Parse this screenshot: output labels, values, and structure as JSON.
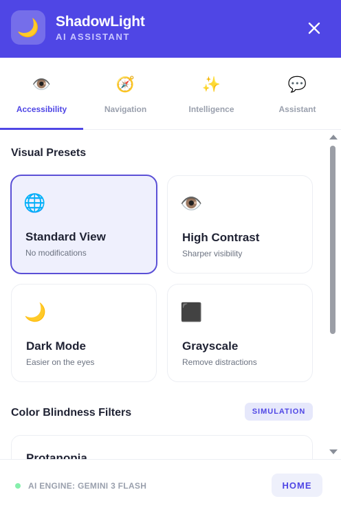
{
  "header": {
    "title": "ShadowLight",
    "subtitle": "AI ASSISTANT",
    "logo_icon": "crescent-moon-icon",
    "logo_glyph": "🌙",
    "close_icon": "close-icon"
  },
  "tabs": [
    {
      "label": "Accessibility",
      "icon": "eye-icon",
      "glyph": "👁️",
      "active": true
    },
    {
      "label": "Navigation",
      "icon": "compass-icon",
      "glyph": "🧭",
      "active": false
    },
    {
      "label": "Intelligence",
      "icon": "sparkles-icon",
      "glyph": "✨",
      "active": false
    },
    {
      "label": "Assistant",
      "icon": "speech-bubble-icon",
      "glyph": "💬",
      "active": false
    }
  ],
  "visual_presets": {
    "title": "Visual Presets",
    "items": [
      {
        "title": "Standard View",
        "subtitle": "No modifications",
        "icon": "globe-icon",
        "glyph": "🌐",
        "selected": true
      },
      {
        "title": "High Contrast",
        "subtitle": "Sharper visibility",
        "icon": "eye-icon",
        "glyph": "👁️",
        "selected": false
      },
      {
        "title": "Dark Mode",
        "subtitle": "Easier on the eyes",
        "icon": "crescent-moon-icon",
        "glyph": "🌙",
        "selected": false
      },
      {
        "title": "Grayscale",
        "subtitle": "Remove distractions",
        "icon": "black-square-icon",
        "glyph": "⬛",
        "selected": false
      }
    ]
  },
  "color_blindness": {
    "title": "Color Blindness Filters",
    "badge": "SIMULATION",
    "items": [
      {
        "title": "Protanopia"
      }
    ]
  },
  "footer": {
    "status": "AI ENGINE: GEMINI 3 FLASH",
    "home_label": "HOME"
  },
  "colors": {
    "accent": "#4f46e5",
    "selected_bg": "#eff0fd",
    "status_dot": "#86efac"
  }
}
